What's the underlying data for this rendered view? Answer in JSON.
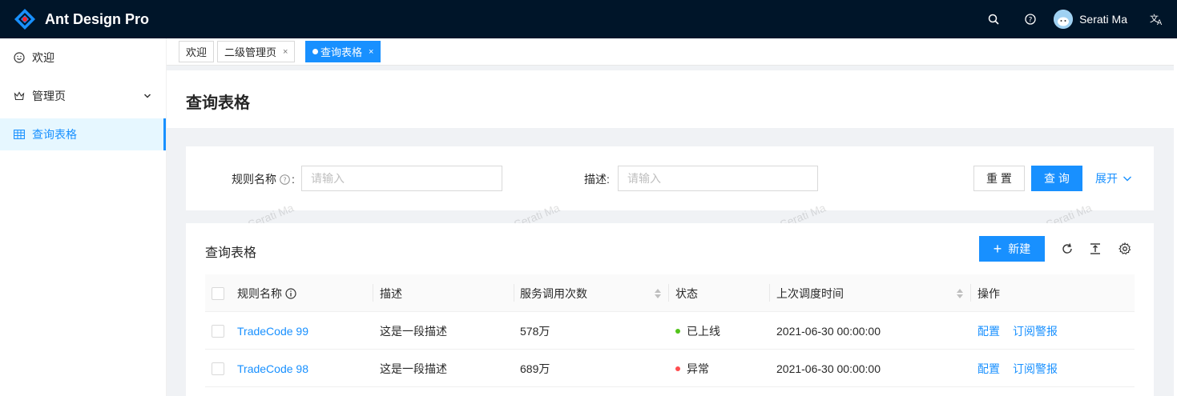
{
  "header": {
    "app_title": "Ant Design Pro",
    "user_name": "Serati Ma",
    "colors": {
      "bg": "#001529",
      "primary": "#1890ff"
    }
  },
  "sidebar": {
    "items": [
      {
        "label": "欢迎",
        "icon": "smile-icon"
      },
      {
        "label": "管理页",
        "icon": "crown-icon"
      },
      {
        "label": "查询表格",
        "icon": "table-icon",
        "active": true
      }
    ]
  },
  "tabs": [
    {
      "label": "欢迎"
    },
    {
      "label": "二级管理页",
      "close": "×"
    },
    {
      "label": "查询表格",
      "close": "×",
      "active": true
    }
  ],
  "page": {
    "title": "查询表格"
  },
  "search": {
    "rule_name_label": "规则名称",
    "rule_name_placeholder": "请输入",
    "desc_label": "描述:",
    "desc_placeholder": "请输入",
    "reset_label": "重 置",
    "query_label": "查 询",
    "expand_label": "展开"
  },
  "watermark": "Serati Ma",
  "table": {
    "title": "查询表格",
    "new_label": "新建",
    "columns": [
      "规则名称",
      "描述",
      "服务调用次数",
      "状态",
      "上次调度时间",
      "操作"
    ],
    "rows": [
      {
        "name": "TradeCode 99",
        "desc": "这是一段描述",
        "calls": "578万",
        "status": "已上线",
        "status_color": "#52c41a",
        "time": "2021-06-30 00:00:00",
        "action1": "配置",
        "action2": "订阅警报"
      },
      {
        "name": "TradeCode 98",
        "desc": "这是一段描述",
        "calls": "689万",
        "status": "异常",
        "status_color": "#ff4d4f",
        "time": "2021-06-30 00:00:00",
        "action1": "配置",
        "action2": "订阅警报"
      }
    ]
  }
}
